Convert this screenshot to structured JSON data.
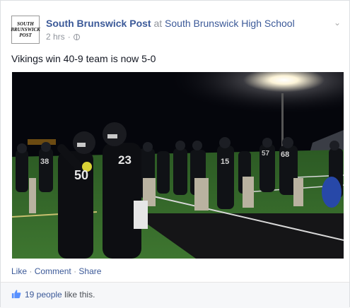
{
  "post": {
    "logo_text": [
      "SOUTH",
      "BRUNSWICK",
      "POST"
    ],
    "page_name": "South Brunswick Post",
    "at": "at",
    "location": "South Brunswick High School",
    "time": "2 hrs",
    "dot": "·",
    "text": "Vikings win 40-9 team is now 5-0"
  },
  "actions": {
    "like": "Like",
    "comment": "Comment",
    "share": "Share",
    "separator": "·"
  },
  "likes": {
    "count_label": "19 people",
    "suffix": "like this."
  },
  "photo": {
    "jersey_numbers": [
      "50",
      "23",
      "38",
      "15",
      "68",
      "57"
    ]
  }
}
